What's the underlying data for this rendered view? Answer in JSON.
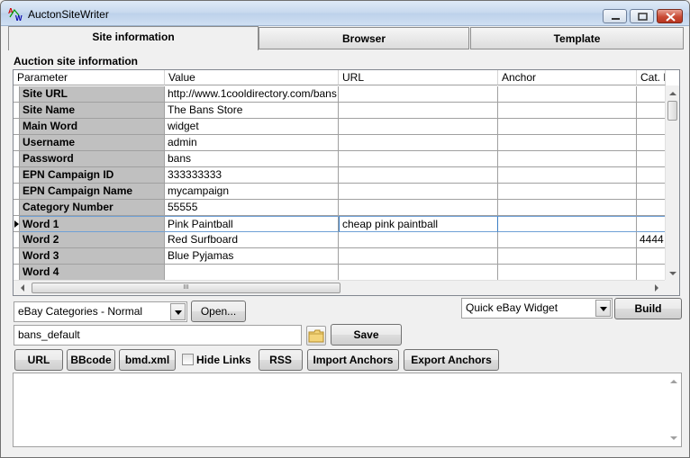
{
  "window": {
    "title": "AuctonSiteWriter"
  },
  "tabs": [
    {
      "label": "Site information",
      "active": true
    },
    {
      "label": "Browser",
      "active": false
    },
    {
      "label": "Template",
      "active": false
    }
  ],
  "section": {
    "title": "Auction site information"
  },
  "grid": {
    "columns": [
      "Parameter",
      "Value",
      "URL",
      "Anchor",
      "Cat. N"
    ],
    "rows": [
      {
        "param": "Site URL",
        "value": "http://www.1cooldirectory.com/bans",
        "url": "",
        "anchor": "",
        "cat": ""
      },
      {
        "param": "Site Name",
        "value": "The Bans Store",
        "url": "",
        "anchor": "",
        "cat": ""
      },
      {
        "param": "Main Word",
        "value": "widget",
        "url": "",
        "anchor": "",
        "cat": ""
      },
      {
        "param": "Username",
        "value": "admin",
        "url": "",
        "anchor": "",
        "cat": ""
      },
      {
        "param": "Password",
        "value": "bans",
        "url": "",
        "anchor": "",
        "cat": ""
      },
      {
        "param": "EPN Campaign ID",
        "value": "333333333",
        "url": "",
        "anchor": "",
        "cat": ""
      },
      {
        "param": "EPN Campaign Name",
        "value": "mycampaign",
        "url": "",
        "anchor": "",
        "cat": ""
      },
      {
        "param": "Category Number",
        "value": "55555",
        "url": "",
        "anchor": "",
        "cat": ""
      },
      {
        "param": "Word   1",
        "value": "Pink Paintball",
        "url": "cheap pink paintball",
        "anchor": "",
        "cat": ""
      },
      {
        "param": "Word   2",
        "value": "Red Surfboard",
        "url": "",
        "anchor": "",
        "cat": "4444"
      },
      {
        "param": "Word   3",
        "value": "Blue Pyjamas",
        "url": "",
        "anchor": "",
        "cat": ""
      },
      {
        "param": "Word   4",
        "value": "",
        "url": "",
        "anchor": "",
        "cat": ""
      }
    ],
    "current_row": 8,
    "hscroll_grip": "III"
  },
  "controls": {
    "category_select": "eBay Categories - Normal",
    "open_label": "Open...",
    "widget_select": "Quick eBay Widget",
    "build_label": "Build",
    "filename_value": "bans_default",
    "save_label": "Save",
    "url_label": "URL",
    "bbcode_label": "BBcode",
    "bmd_label": "bmd.xml",
    "hide_links_label": "Hide Links",
    "hide_links_checked": false,
    "rss_label": "RSS",
    "import_label": "Import Anchors",
    "export_label": "Export Anchors"
  },
  "output": {
    "text": ""
  }
}
